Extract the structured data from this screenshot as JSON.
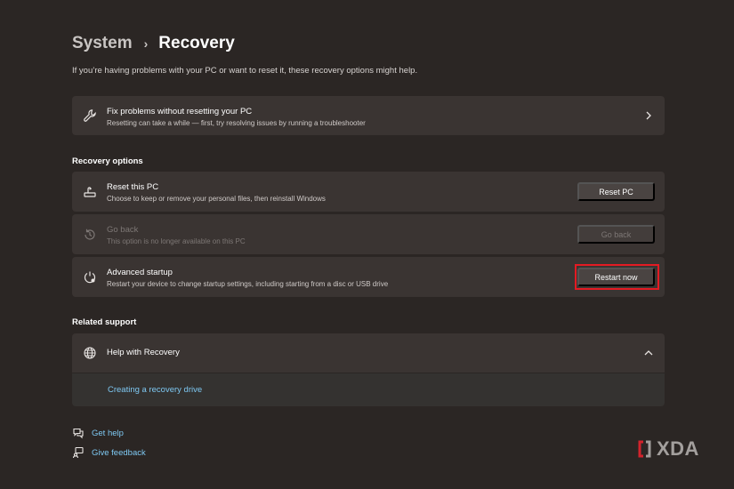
{
  "breadcrumb": {
    "parent": "System",
    "separator": "›",
    "current": "Recovery"
  },
  "intro": "If you’re having problems with your PC or want to reset it, these recovery options might help.",
  "fix_card": {
    "title": "Fix problems without resetting your PC",
    "description": "Resetting can take a while — first, try resolving issues by running a troubleshooter",
    "icon": "wrench-icon"
  },
  "recovery_options": {
    "heading": "Recovery options",
    "items": [
      {
        "title": "Reset this PC",
        "description": "Choose to keep or remove your personal files, then reinstall Windows",
        "button": "Reset PC",
        "icon": "reset-pc-icon",
        "enabled": true
      },
      {
        "title": "Go back",
        "description": "This option is no longer available on this PC",
        "button": "Go back",
        "icon": "history-icon",
        "enabled": false
      },
      {
        "title": "Advanced startup",
        "description": "Restart your device to change startup settings, including starting from a disc or USB drive",
        "button": "Restart now",
        "icon": "advanced-startup-icon",
        "enabled": true
      }
    ]
  },
  "related_support": {
    "heading": "Related support",
    "help_title": "Help with Recovery",
    "help_link": "Creating a recovery drive",
    "icon": "globe-icon"
  },
  "footer": {
    "get_help": "Get help",
    "give_feedback": "Give feedback"
  },
  "watermark": {
    "text": "XDA"
  },
  "colors": {
    "background": "#2b2624",
    "card": "#3a3432",
    "link": "#7ec8f2",
    "highlight": "#e31b23"
  }
}
